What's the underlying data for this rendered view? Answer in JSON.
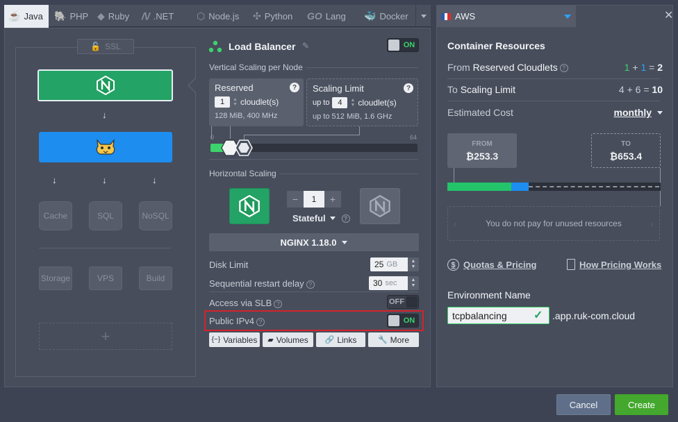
{
  "tabs": [
    {
      "label": "Java",
      "icon": "java-icon",
      "active": true
    },
    {
      "label": "PHP",
      "icon": "php-icon"
    },
    {
      "label": "Ruby",
      "icon": "ruby-icon"
    },
    {
      "label": ".NET",
      "icon": "dotnet-icon"
    },
    {
      "label": "Node.js",
      "icon": "nodejs-icon"
    },
    {
      "label": "Python",
      "icon": "python-icon"
    },
    {
      "label": "Lang",
      "icon": "go-icon",
      "logo_text": "GO"
    },
    {
      "label": "Docker",
      "icon": "docker-icon"
    }
  ],
  "topology": {
    "ssl_label": "SSL",
    "db_nodes": [
      "Cache",
      "SQL",
      "NoSQL"
    ],
    "extra_nodes": [
      "Storage",
      "VPS",
      "Build"
    ],
    "add_label": "+"
  },
  "config": {
    "title": "Load Balancer",
    "title_toggle": "ON",
    "vertical_label": "Vertical Scaling per Node",
    "reserved": {
      "title": "Reserved",
      "value": "1",
      "unit": "cloudlet(s)",
      "spec": "128 MiB, 400 MHz"
    },
    "limit": {
      "title": "Scaling Limit",
      "prefix": "up to",
      "value": "4",
      "unit": "cloudlet(s)",
      "spec_prefix": "up to",
      "spec": "512 MiB, 1.6 GHz"
    },
    "slider": {
      "min_label": "0",
      "max_label": "64",
      "reserved": 1,
      "limit": 4,
      "max": 64
    },
    "horizontal_label": "Horizontal Scaling",
    "node_count": "1",
    "minus": "−",
    "plus": "+",
    "stateful_label": "Stateful",
    "version": "NGINX 1.18.0",
    "disk_label": "Disk Limit",
    "disk_value": "25",
    "disk_unit": "GB",
    "restart_label": "Sequential restart delay",
    "restart_value": "30",
    "restart_unit": "sec",
    "slb_label": "Access via SLB",
    "slb_toggle": "OFF",
    "ipv4_label": "Public IPv4",
    "ipv4_toggle": "ON",
    "buttons": [
      "Variables",
      "Volumes",
      "Links",
      "More"
    ]
  },
  "region": {
    "name": "AWS"
  },
  "resources": {
    "title": "Container Resources",
    "from_label": "From",
    "from_bold": "Reserved Cloudlets",
    "from_a": "1",
    "from_b": "1",
    "from_total": "2",
    "to_label": "To",
    "to_bold": "Scaling Limit",
    "to_a": "4",
    "to_b": "6",
    "to_total": "10",
    "cost_label": "Estimated Cost",
    "period": "monthly",
    "from_price_label": "FROM",
    "from_price": "₿253.3",
    "to_price_label": "TO",
    "to_price": "₿653.4",
    "bar": {
      "green": 0.3,
      "blue": 0.08
    },
    "no_pay": "You do not pay for unused resources",
    "quotas_link": "Quotas & Pricing",
    "how_link": "How Pricing Works",
    "env_label": "Environment Name",
    "env_value": "tcpbalancing",
    "domain": ".app.ruk-com.cloud"
  },
  "footer": {
    "cancel": "Cancel",
    "create": "Create"
  },
  "colors": {
    "green": "#23a365",
    "blue": "#1d8df0",
    "accent_green": "#3dd36c",
    "highlight_red": "#d4232b"
  }
}
